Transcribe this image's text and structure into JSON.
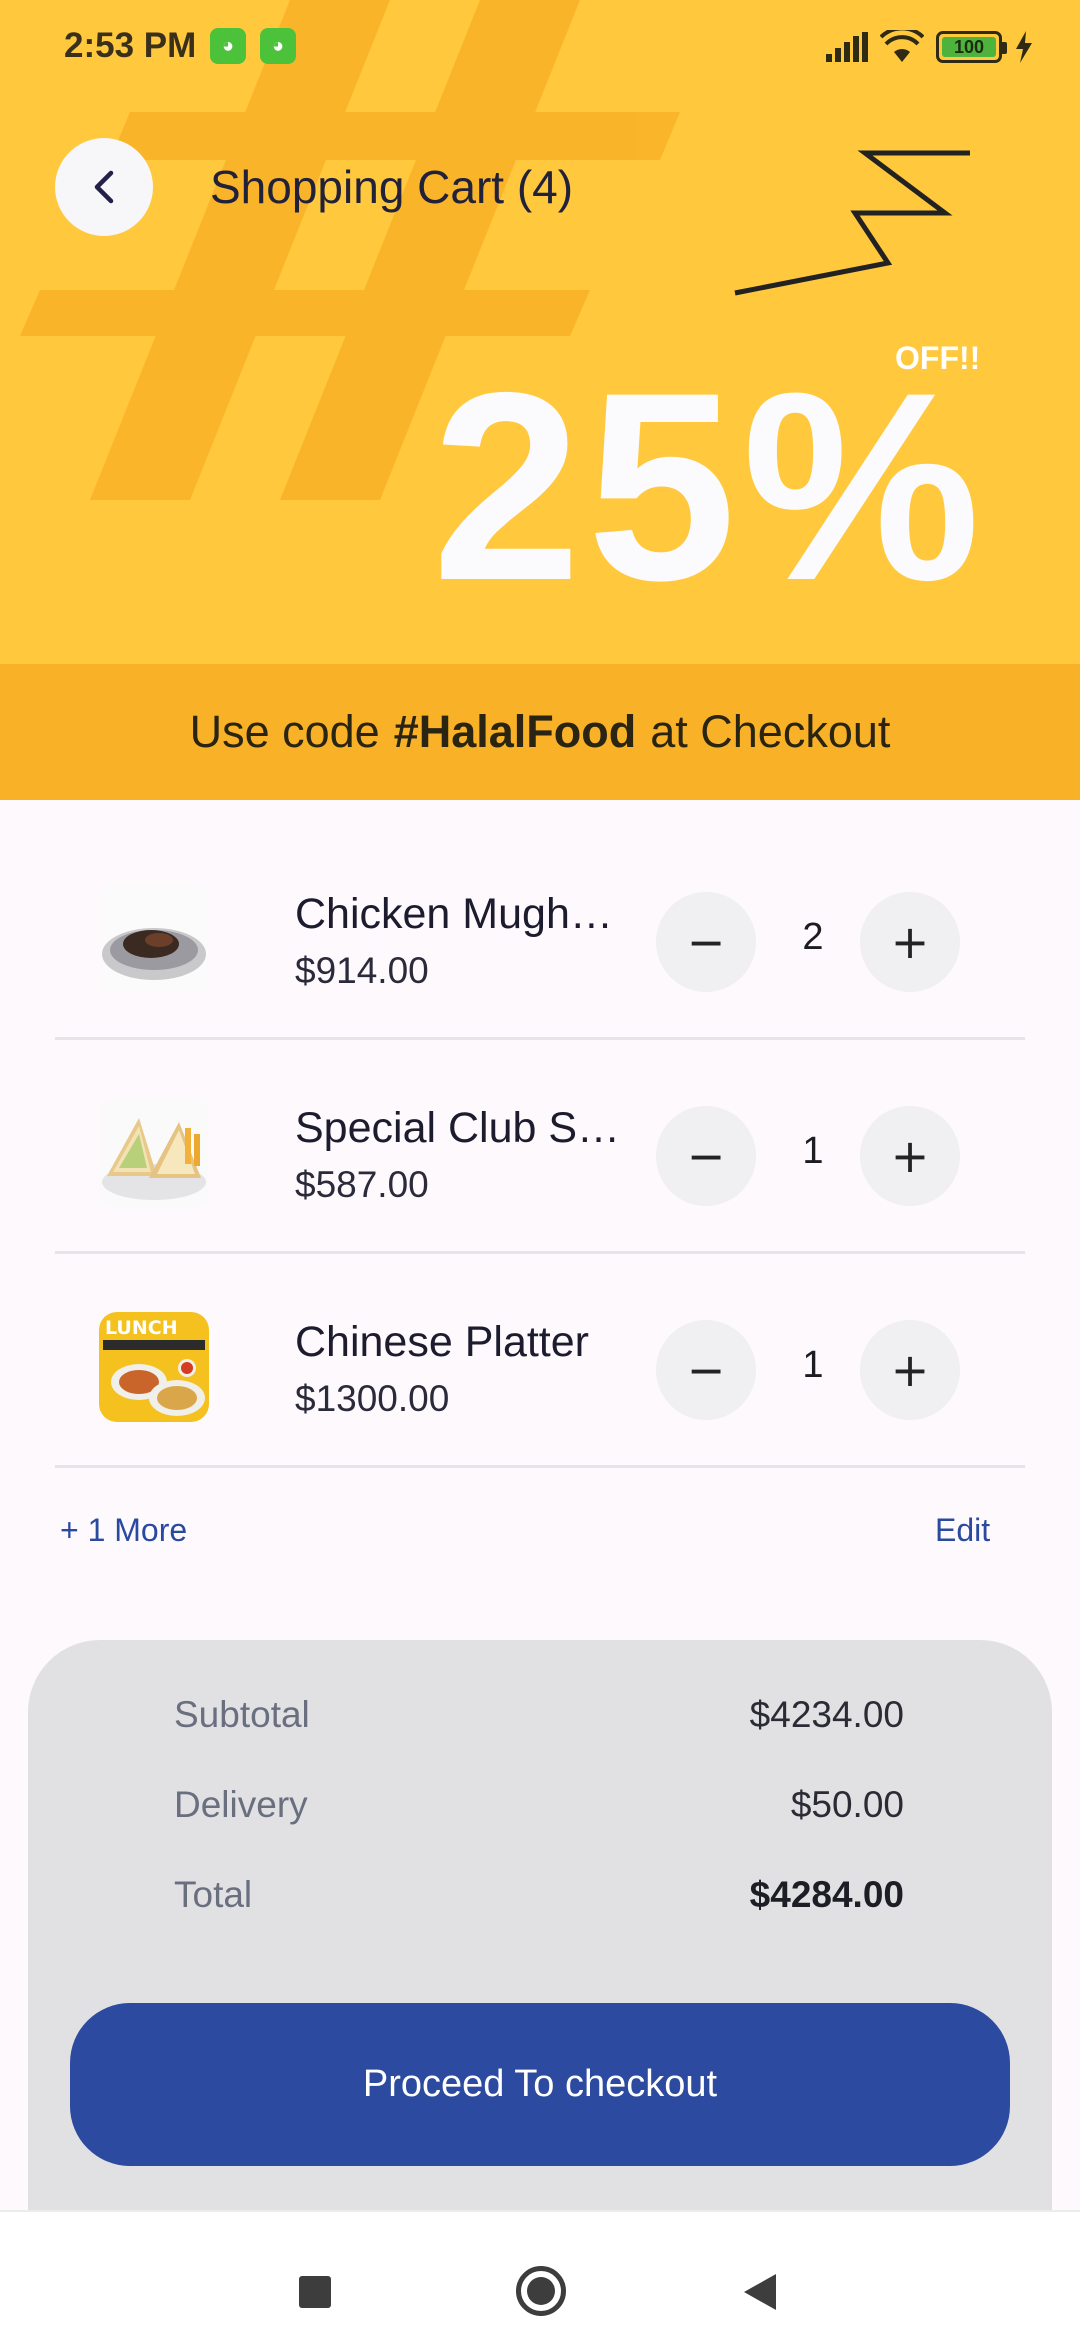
{
  "status_bar": {
    "time": "2:53 PM",
    "battery": "100",
    "app_icons": [
      "cat-app-icon",
      "cat-app-icon"
    ]
  },
  "header": {
    "title": "Shopping Cart (4)"
  },
  "promo": {
    "off_label": "OFF!!",
    "discount": "25%",
    "code_prefix": "Use code",
    "code": "#HalalFood",
    "code_suffix": "at Checkout"
  },
  "cart": {
    "items": [
      {
        "name": "Chicken Mugh…",
        "price": "$914.00",
        "quantity": "2",
        "thumb": "sizzler-plate-photo"
      },
      {
        "name": "Special Club S…",
        "price": "$587.00",
        "quantity": "1",
        "thumb": "club-sandwich-photo"
      },
      {
        "name": "Chinese Platter",
        "price": "$1300.00",
        "quantity": "1",
        "thumb": "lunch-special-platter-photo"
      }
    ],
    "minus_symbol": "−",
    "plus_symbol": "+",
    "more_label": "+ 1 More",
    "edit_label": "Edit"
  },
  "summary": {
    "subtotal_label": "Subtotal",
    "subtotal_value": "$4234.00",
    "delivery_label": "Delivery",
    "delivery_value": "$50.00",
    "total_label": "Total",
    "total_value": "$4284.00",
    "checkout_label": "Proceed To checkout"
  },
  "colors": {
    "hero_yellow": "#ffc83d",
    "promo_orange": "#f9b127",
    "primary_blue": "#2c4a9f",
    "link_blue": "#2a4aa0"
  }
}
